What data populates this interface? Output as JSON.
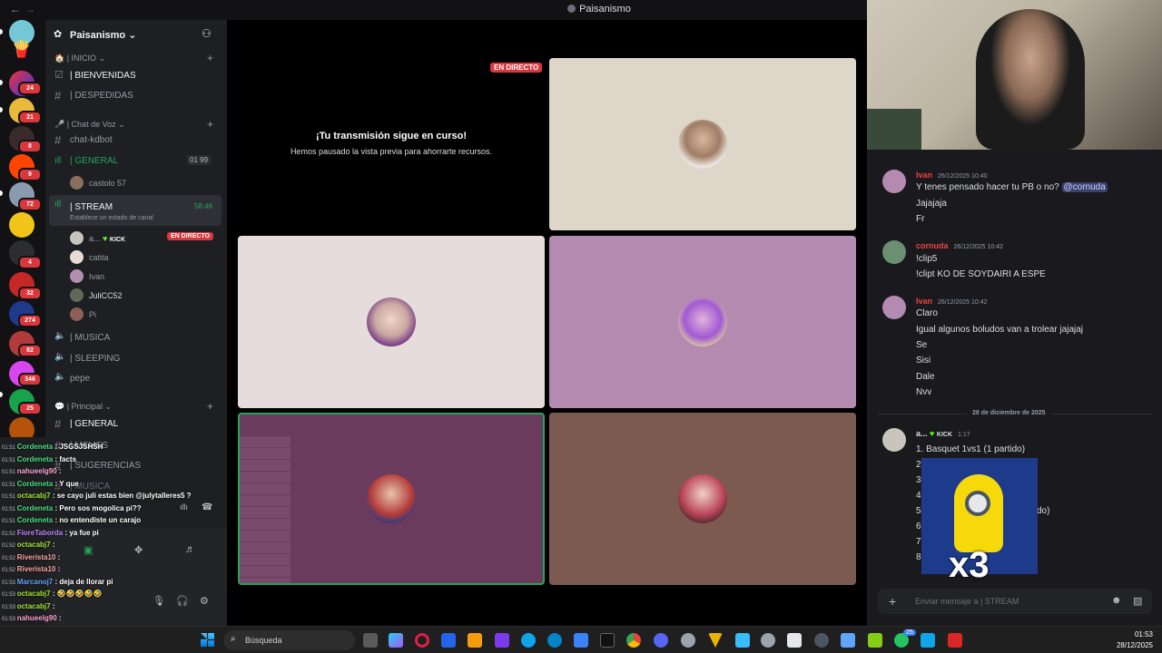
{
  "window": {
    "title": "Paisanismo"
  },
  "server": {
    "name": "Paisanismo"
  },
  "rail_badges": [
    "24",
    "21",
    "8",
    "9",
    "72",
    "4",
    "32",
    "274",
    "82",
    "346",
    "25"
  ],
  "categories": {
    "inicio": "| INICIO",
    "voice_chat": "| Chat de Voz",
    "principal": "| Principal"
  },
  "channels": {
    "bienvenidas": "| BIENVENIDAS",
    "despedidas": "| DESPEDIDAS",
    "chat_kdbot": "chat-kdbot",
    "general_voice": "| GENERAL",
    "general_voice_counter": "01 99",
    "stream": "| STREAM",
    "stream_time": "58:46",
    "stream_status": "Establece un estado de canal",
    "musica": "| MUSICA",
    "sleeping": "| SLEEPING",
    "pepe": "pepe",
    "general_text": "| GENERAL",
    "memes": "| MEMES",
    "sugerencias": "| SUGERENCIAS",
    "musica_text": "| MUSICA"
  },
  "voice_users": {
    "general": [
      "castolo 57"
    ],
    "stream": [
      {
        "name": "a...",
        "tag": "KICK",
        "live": "EN DIRECTO"
      },
      {
        "name": "catita"
      },
      {
        "name": "Ivan"
      },
      {
        "name": "JuliCC52"
      },
      {
        "name": "Pi"
      }
    ]
  },
  "overlay_chat": [
    {
      "time": "01:51",
      "user": "Cordeneta",
      "text": ": JSGSJSHSH",
      "color": "#4ade80"
    },
    {
      "time": "01:51",
      "user": "Cordeneta",
      "text": ": facts",
      "color": "#4ade80"
    },
    {
      "time": "01:51",
      "user": "nahueelg90",
      "text": ":",
      "color": "#f9a8d4"
    },
    {
      "time": "01:51",
      "user": "Cordeneta",
      "text": ": Y que",
      "color": "#4ade80"
    },
    {
      "time": "01:51",
      "user": "octacabj7",
      "text": ": se cayo juli estas bien @julytalleres5 ?",
      "color": "#a3e635"
    },
    {
      "time": "01:51",
      "user": "Cordeneta",
      "text": ": Pero sos mogolica pi??",
      "color": "#4ade80"
    },
    {
      "time": "01:51",
      "user": "Cordeneta",
      "text": ": no entendiste un carajo",
      "color": "#4ade80"
    },
    {
      "time": "01:52",
      "user": "FioreTaborda",
      "text": ": ya fue pi",
      "color": "#c084fc"
    },
    {
      "time": "01:52",
      "user": "octacabj7",
      "text": ":",
      "color": "#a3e635"
    },
    {
      "time": "01:52",
      "user": "Riverista10",
      "text": ":",
      "color": "#fca5a5"
    },
    {
      "time": "01:52",
      "user": "Riverista10",
      "text": ":",
      "color": "#fca5a5"
    },
    {
      "time": "01:53",
      "user": "Marcanoj7",
      "text": ": deja de llorar pi",
      "color": "#60a5fa"
    },
    {
      "time": "01:53",
      "user": "octacabj7",
      "text": ": 🤣🤣🤣🤣🤣",
      "color": "#a3e635"
    },
    {
      "time": "01:53",
      "user": "octacabj7",
      "text": ":",
      "color": "#a3e635"
    },
    {
      "time": "01:53",
      "user": "nahueelg90",
      "text": ":",
      "color": "#f9a8d4"
    }
  ],
  "stage": {
    "live_badge": "EN DIRECTO",
    "paused_title": "¡Tu transmisión sigue en curso!",
    "paused_sub": "Hemos pausado la vista previa para ahorrarte recursos."
  },
  "chat_pane": {
    "messages": [
      {
        "author": "Ivan",
        "color": "#f23f43",
        "time": "26/12/2025 10:40",
        "lines": [
          "Y tenes pensado hacer tu PB o no?",
          "Jajajaja",
          "Fr"
        ],
        "mention": "@cornuda"
      },
      {
        "author": "cornuda",
        "color": "#f23f43",
        "time": "26/12/2025 10:42",
        "lines": [
          "!clip5",
          "!clipt KO DE SOYDAIRI A ESPE"
        ]
      },
      {
        "author": "Ivan",
        "color": "#f23f43",
        "time": "26/12/2025 10:42",
        "lines": [
          "Claro",
          "Igual algunos boludos van a trolear jajajaj",
          "Se",
          "Sisi",
          "Dale",
          "Nvv"
        ]
      },
      {
        "author": "a...",
        "color": "#dbdee1",
        "tag": "KICK",
        "time": "1:17",
        "lines": [
          "1. Basquet 1vs1 (1 partido)",
          "2.",
          "3.",
          "4.",
          "5.",
          "6.",
          "7.",
          "8."
        ],
        "line_end": "do)"
      }
    ],
    "date_divider": "28 de diciembre de 2025",
    "sticker_text": "x3",
    "input_placeholder": "Enviar mensaje a | STREAM"
  },
  "taskbar": {
    "search": "Búsqueda",
    "time": "01:53",
    "date": "28/12/2025",
    "notif_badge": "25"
  }
}
